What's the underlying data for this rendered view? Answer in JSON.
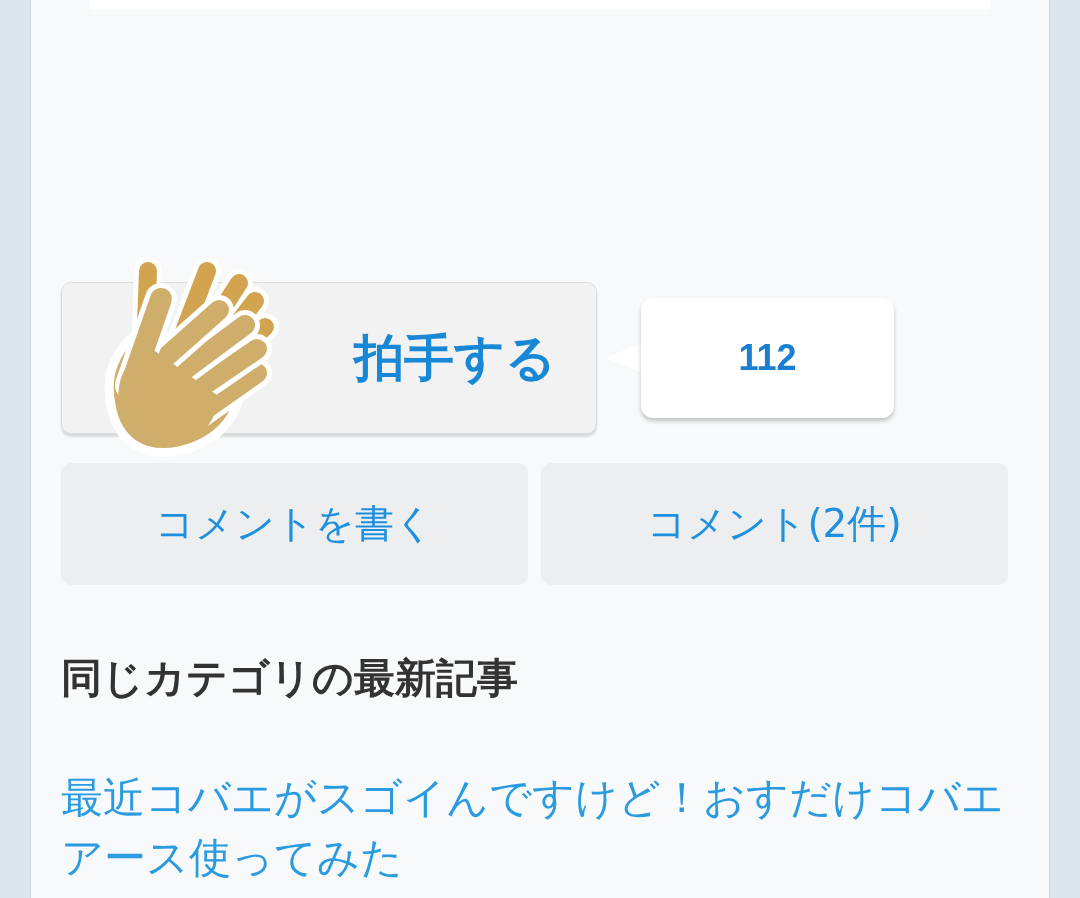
{
  "clap": {
    "label": "拍手する",
    "count": "112"
  },
  "comment_buttons": [
    {
      "label": "コメントを書く"
    },
    {
      "label": "コメント(2件)"
    }
  ],
  "related": {
    "heading": "同じカテゴリの最新記事",
    "articles": [
      {
        "title": "最近コバエがスゴイんですけど！おすだけコバエアース使ってみた"
      }
    ]
  }
}
